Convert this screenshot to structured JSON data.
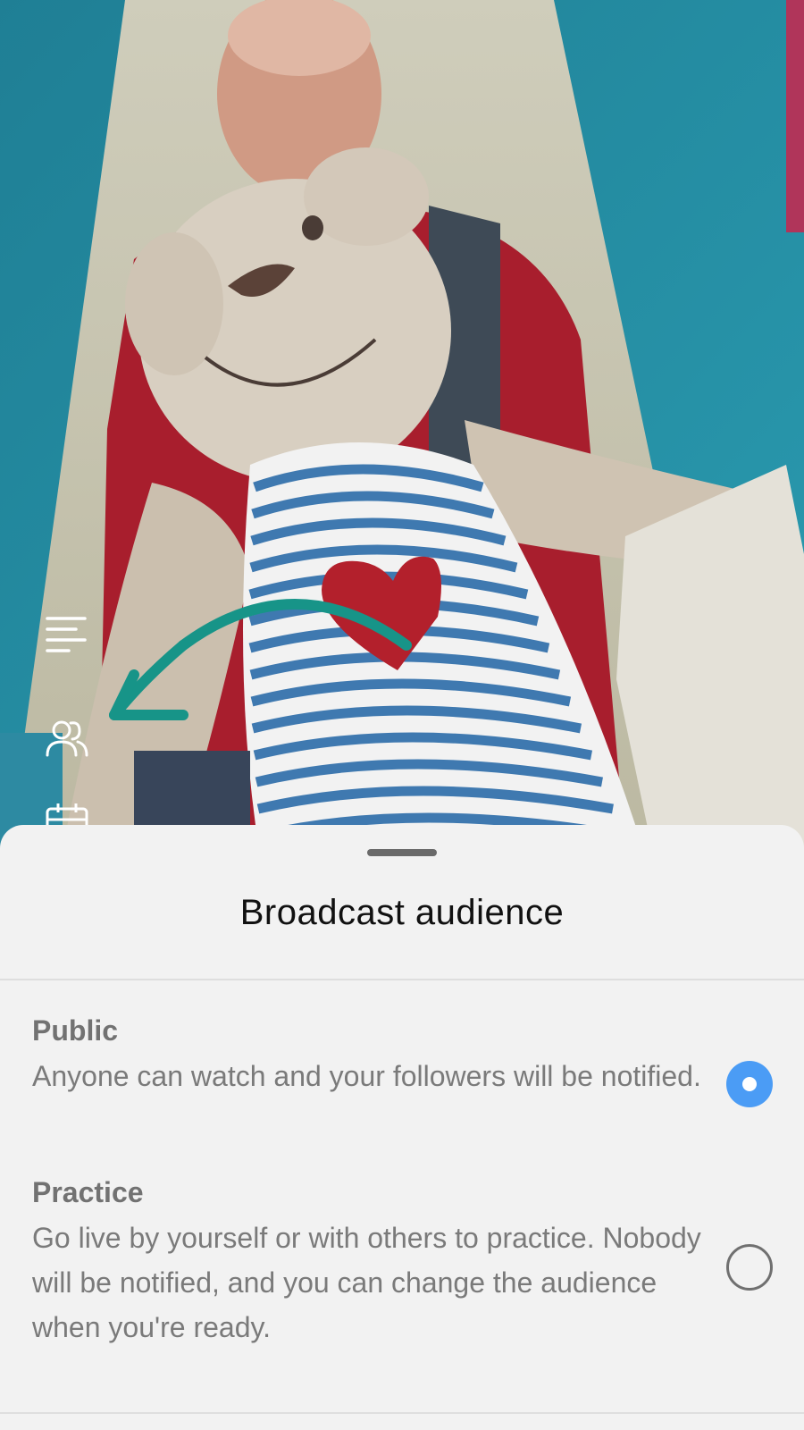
{
  "sheet": {
    "title": "Broadcast audience",
    "options": [
      {
        "title": "Public",
        "description": "Anyone can watch and your followers will be notified.",
        "selected": true
      },
      {
        "title": "Practice",
        "description": "Go live by yourself or with others to practice. Nobody will be notified, and you can change the audience when you're ready.",
        "selected": false
      }
    ]
  },
  "side_toolbar": {
    "icons": [
      "menu-icon",
      "audience-icon",
      "calendar-icon"
    ]
  },
  "colors": {
    "accent_radio": "#4b9cf5",
    "tutorial_arrow": "#179488",
    "sheet_background": "#f2f2f2"
  }
}
